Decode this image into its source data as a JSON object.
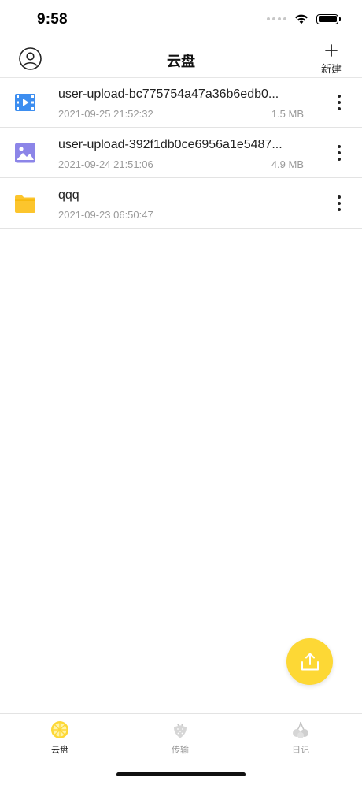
{
  "status_bar": {
    "time": "9:58"
  },
  "header": {
    "title": "云盘",
    "new_label": "新建"
  },
  "files": [
    {
      "icon": "video-file-icon",
      "name": "user-upload-bc775754a47a36b6edb0...",
      "date": "2021-09-25 21:52:32",
      "size": "1.5 MB"
    },
    {
      "icon": "image-file-icon",
      "name": "user-upload-392f1db0ce6956a1e5487...",
      "date": "2021-09-24 21:51:06",
      "size": "4.9 MB"
    },
    {
      "icon": "folder-icon",
      "name": "qqq",
      "date": "2021-09-23 06:50:47",
      "size": ""
    }
  ],
  "tabs": [
    {
      "label": "云盘",
      "icon": "lemon-icon",
      "active": true
    },
    {
      "label": "传输",
      "icon": "strawberry-icon",
      "active": false
    },
    {
      "label": "日记",
      "icon": "cherry-icon",
      "active": false
    }
  ],
  "colors": {
    "accent_yellow": "#fdd835",
    "video_blue": "#3d8ef0",
    "image_purple": "#8c85e8",
    "folder_yellow": "#fcc52d",
    "secondary_text": "#9a9a9a"
  }
}
